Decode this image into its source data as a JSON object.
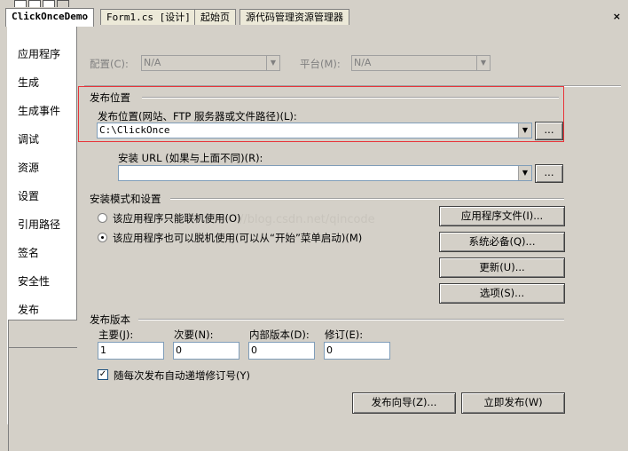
{
  "tabs": [
    {
      "label": "ClickOnceDemo",
      "active": true
    },
    {
      "label": "Form1.cs [设计]",
      "active": false
    },
    {
      "label": "起始页",
      "active": false
    },
    {
      "label": "源代码管理资源管理器",
      "active": false
    }
  ],
  "close_glyph": "×",
  "sidebar": {
    "items": [
      "应用程序",
      "生成",
      "生成事件",
      "调试",
      "资源",
      "设置",
      "引用路径",
      "签名",
      "安全性",
      "发布"
    ],
    "active": "发布"
  },
  "config": {
    "config_label": "配置(C):",
    "config_value": "N/A",
    "platform_label": "平台(M):",
    "platform_value": "N/A"
  },
  "publish_location": {
    "section_title": "发布位置",
    "location_label": "发布位置(网站、FTP 服务器或文件路径)(L):",
    "location_value": "C:\\ClickOnce",
    "install_url_label": "安装 URL (如果与上面不同)(R):",
    "install_url_value": "",
    "browse_label": "..."
  },
  "install_mode": {
    "section_title": "安装模式和设置",
    "option_online": "该应用程序只能联机使用(O)",
    "option_offline": "该应用程序也可以脱机使用(可以从“开始”菜单启动)(M)",
    "selected": "offline",
    "buttons": {
      "app_files": "应用程序文件(I)...",
      "prerequisites": "系统必备(Q)...",
      "updates": "更新(U)...",
      "options": "选项(S)..."
    }
  },
  "publish_version": {
    "section_title": "发布版本",
    "major_label": "主要(J):",
    "minor_label": "次要(N):",
    "build_label": "内部版本(D):",
    "revision_label": "修订(E):",
    "major": "1",
    "minor": "0",
    "build": "0",
    "revision": "0",
    "auto_increment_label": "随每次发布自动递增修订号(Y)",
    "auto_increment": true,
    "check_glyph": "✓"
  },
  "actions": {
    "wizard": "发布向导(Z)...",
    "publish_now": "立即发布(W)"
  },
  "watermark": "//blog.csdn.net/qincode"
}
